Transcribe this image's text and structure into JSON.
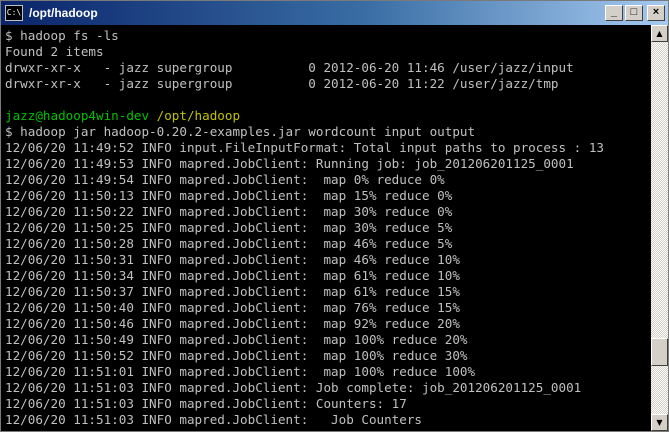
{
  "window": {
    "title": "/opt/hadoop",
    "icon_label": "C:\\",
    "icon": "console-icon",
    "controls": {
      "minimize": "_",
      "maximize": "□",
      "close": "×"
    }
  },
  "console": {
    "lines": [
      {
        "text": "$ hadoop fs -ls",
        "style": "normal"
      },
      {
        "text": "Found 2 items",
        "style": "normal"
      },
      {
        "text": "drwxr-xr-x   - jazz supergroup          0 2012-06-20 11:46 /user/jazz/input",
        "style": "normal"
      },
      {
        "text": "drwxr-xr-x   - jazz supergroup          0 2012-06-20 11:22 /user/jazz/tmp",
        "style": "normal"
      },
      {
        "text": "",
        "style": "normal"
      },
      {
        "text": "jazz@hadoop4win-dev /opt/hadoop",
        "style": "prompt"
      },
      {
        "text": "$ hadoop jar hadoop-0.20.2-examples.jar wordcount input output",
        "style": "normal"
      },
      {
        "text": "12/06/20 11:49:52 INFO input.FileInputFormat: Total input paths to process : 13",
        "style": "normal"
      },
      {
        "text": "12/06/20 11:49:53 INFO mapred.JobClient: Running job: job_201206201125_0001",
        "style": "normal"
      },
      {
        "text": "12/06/20 11:49:54 INFO mapred.JobClient:  map 0% reduce 0%",
        "style": "normal"
      },
      {
        "text": "12/06/20 11:50:13 INFO mapred.JobClient:  map 15% reduce 0%",
        "style": "normal"
      },
      {
        "text": "12/06/20 11:50:22 INFO mapred.JobClient:  map 30% reduce 0%",
        "style": "normal"
      },
      {
        "text": "12/06/20 11:50:25 INFO mapred.JobClient:  map 30% reduce 5%",
        "style": "normal"
      },
      {
        "text": "12/06/20 11:50:28 INFO mapred.JobClient:  map 46% reduce 5%",
        "style": "normal"
      },
      {
        "text": "12/06/20 11:50:31 INFO mapred.JobClient:  map 46% reduce 10%",
        "style": "normal"
      },
      {
        "text": "12/06/20 11:50:34 INFO mapred.JobClient:  map 61% reduce 10%",
        "style": "normal"
      },
      {
        "text": "12/06/20 11:50:37 INFO mapred.JobClient:  map 61% reduce 15%",
        "style": "normal"
      },
      {
        "text": "12/06/20 11:50:40 INFO mapred.JobClient:  map 76% reduce 15%",
        "style": "normal"
      },
      {
        "text": "12/06/20 11:50:46 INFO mapred.JobClient:  map 92% reduce 20%",
        "style": "normal"
      },
      {
        "text": "12/06/20 11:50:49 INFO mapred.JobClient:  map 100% reduce 20%",
        "style": "normal"
      },
      {
        "text": "12/06/20 11:50:52 INFO mapred.JobClient:  map 100% reduce 30%",
        "style": "normal"
      },
      {
        "text": "12/06/20 11:51:01 INFO mapred.JobClient:  map 100% reduce 100%",
        "style": "normal"
      },
      {
        "text": "12/06/20 11:51:03 INFO mapred.JobClient: Job complete: job_201206201125_0001",
        "style": "normal"
      },
      {
        "text": "12/06/20 11:51:03 INFO mapred.JobClient: Counters: 17",
        "style": "normal"
      },
      {
        "text": "12/06/20 11:51:03 INFO mapred.JobClient:   Job Counters",
        "style": "normal"
      }
    ]
  },
  "scrollbar": {
    "up_icon": "scroll-up-arrow-icon",
    "down_icon": "scroll-down-arrow-icon",
    "up_glyph": "▲",
    "down_glyph": "▼",
    "scroll_position": 0.86
  },
  "colors": {
    "console_bg": "#000000",
    "console_text": "#c0c0c0",
    "prompt_user": "#00c000",
    "prompt_path": "#c0c000",
    "titlebar_start": "#0a246a",
    "titlebar_end": "#a6caf0"
  }
}
